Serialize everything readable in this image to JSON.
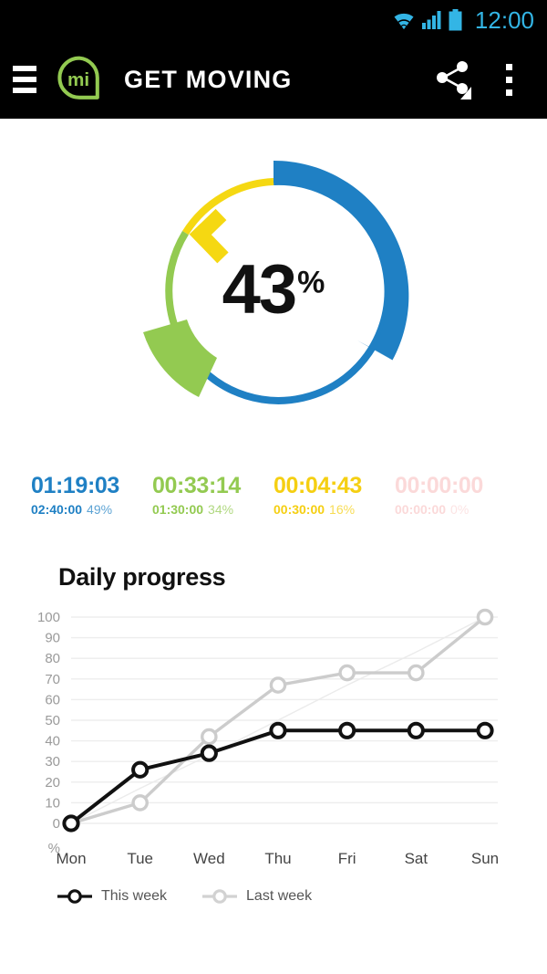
{
  "status_bar": {
    "clock": "12:00",
    "icons": [
      "wifi-icon",
      "cellular-signal-icon",
      "battery-icon"
    ],
    "accent_color": "#33b5e5"
  },
  "app_bar": {
    "menu_icon": "hamburger-menu-icon",
    "logo_text": "mi",
    "logo_color": "#93ca51",
    "title": "GET MOVING",
    "share_icon": "share-icon",
    "share_dropdown_icon": "dropdown-triangle-icon",
    "overflow_icon": "overflow-menu-icon",
    "background": "#000000"
  },
  "donut": {
    "value": "43",
    "unit": "%",
    "segments": [
      {
        "name": "blue-zone",
        "color": "#1f80c4",
        "goal_sweep_deg": 180,
        "progress_sweep_deg": 88,
        "start_deg": 0,
        "label_pct": "49%"
      },
      {
        "name": "green-zone",
        "color": "#93ca51",
        "goal_sweep_deg": 101,
        "progress_sweep_deg": 34,
        "start_deg": 180,
        "label_pct": "34%"
      },
      {
        "name": "yellow-zone",
        "color": "#f5d812",
        "goal_sweep_deg": 45,
        "progress_sweep_deg": 7,
        "start_deg": 281,
        "label_pct": "16%"
      },
      {
        "name": "red-zone",
        "color": "#fbd6d6",
        "goal_sweep_deg": 0,
        "progress_sweep_deg": 0,
        "start_deg": 326,
        "label_pct": "0%"
      }
    ]
  },
  "stats": [
    {
      "name": "zone-blue",
      "elapsed": "01:19:03",
      "goal": "02:40:00",
      "percent": "49%",
      "color": "#1f80c4"
    },
    {
      "name": "zone-green",
      "elapsed": "00:33:14",
      "goal": "01:30:00",
      "percent": "34%",
      "color": "#93ca51"
    },
    {
      "name": "zone-yellow",
      "elapsed": "00:04:43",
      "goal": "00:30:00",
      "percent": "16%",
      "color": "#f5cf12"
    },
    {
      "name": "zone-red",
      "elapsed": "00:00:00",
      "goal": "00:00:00",
      "percent": "0%",
      "color": "#fbd9d9"
    }
  ],
  "chart_section": {
    "title": "Daily progress"
  },
  "chart_data": {
    "type": "line",
    "title": "Daily progress",
    "xlabel": "",
    "ylabel": "%",
    "ylim": [
      0,
      100
    ],
    "yticks": [
      0,
      10,
      20,
      30,
      40,
      50,
      60,
      70,
      80,
      90,
      100
    ],
    "ytick_labels": [
      "0",
      "10",
      "20",
      "30",
      "40",
      "50",
      "60",
      "70",
      "80",
      "90",
      "100"
    ],
    "y_unit_label": "%",
    "categories": [
      "Mon",
      "Tue",
      "Wed",
      "Thu",
      "Fri",
      "Sat",
      "Sun"
    ],
    "grid": true,
    "legend_position": "bottom-left",
    "series": [
      {
        "name": "This week",
        "color": "#111111",
        "marker": "open-circle",
        "values": [
          0,
          26,
          34,
          45,
          45,
          45,
          45
        ]
      },
      {
        "name": "Last week",
        "color": "#cccccc",
        "marker": "open-circle",
        "values": [
          0,
          10,
          42,
          67,
          73,
          73,
          100
        ]
      },
      {
        "name": "reference-trend",
        "color": "#ebebeb",
        "marker": "none",
        "values": [
          0,
          17,
          33,
          50,
          67,
          83,
          100
        ]
      }
    ]
  },
  "legend": [
    {
      "label": "This week",
      "color": "#111111"
    },
    {
      "label": "Last week",
      "color": "#cccccc"
    }
  ]
}
